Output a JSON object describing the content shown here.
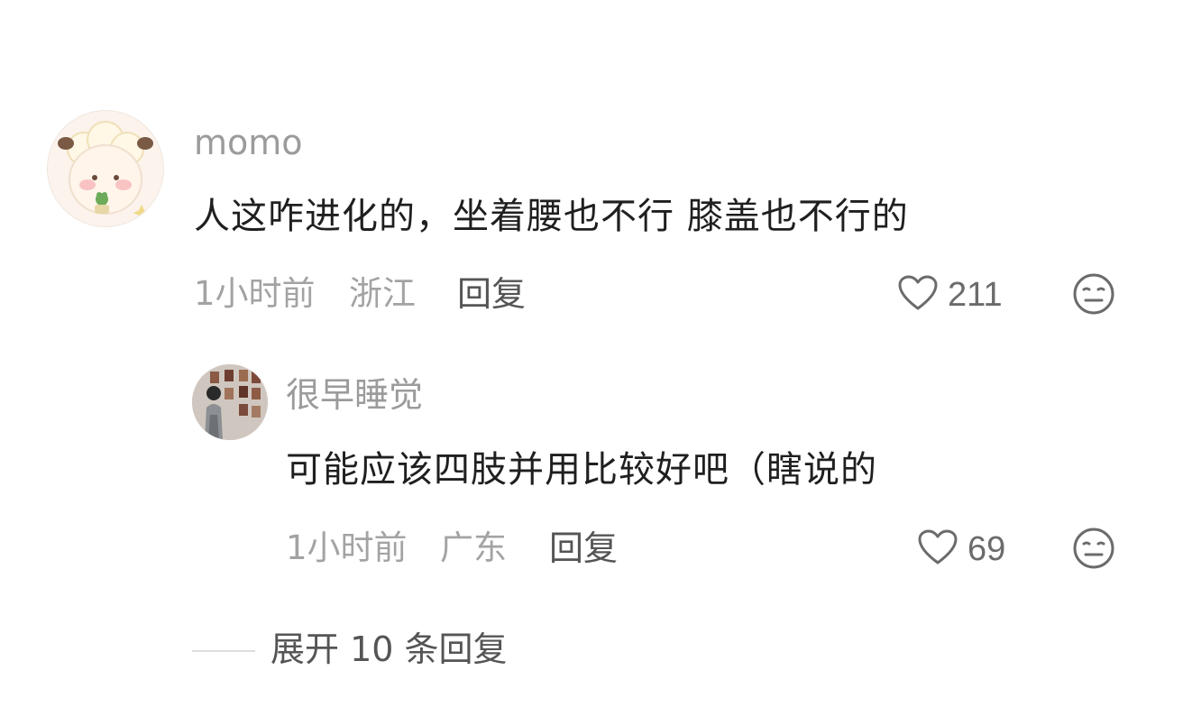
{
  "main_comment": {
    "username": "momo",
    "text": "人这咋进化的，坐着腰也不行 膝盖也不行的",
    "time": "1小时前",
    "location": "浙江",
    "reply_label": "回复",
    "likes": "211"
  },
  "reply_comment": {
    "username": "很早睡觉",
    "text": "可能应该四肢并用比较好吧（瞎说的",
    "time": "1小时前",
    "location": "广东",
    "reply_label": "回复",
    "likes": "69"
  },
  "expand": {
    "label": "展开 10 条回复"
  },
  "icons": {
    "like": "heart-outline-icon",
    "dislike": "meh-face-icon"
  },
  "colors": {
    "username": "#9b9b9b",
    "meta": "#a3a3a3",
    "text": "#1f1f1f"
  }
}
